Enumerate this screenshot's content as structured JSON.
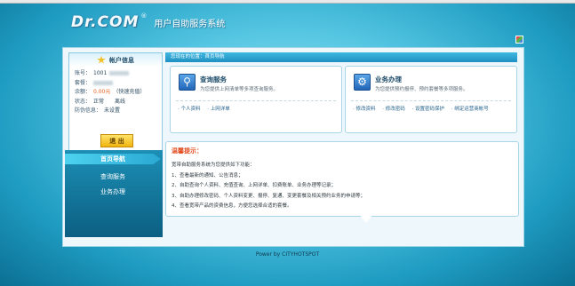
{
  "brand": {
    "logo_text": "Dr.COM",
    "reg_mark": "®",
    "subtitle": "用户自助服务系统"
  },
  "account": {
    "title": "帐户信息",
    "rows": [
      {
        "label": "账号：",
        "value": "1001"
      },
      {
        "label": "套餐：",
        "value": ""
      },
      {
        "label": "余额：",
        "value": "0.00元",
        "extra": "（快速充值）"
      },
      {
        "label": "状态：",
        "value": "正常",
        "extra": "离线"
      },
      {
        "label": "防伪信息：",
        "value": "未设置"
      }
    ],
    "logout_label": "退 出"
  },
  "nav": {
    "head": "首页导航",
    "items": [
      "查询服务",
      "业务办理"
    ]
  },
  "breadcrumb": "您现在的位置：首页导航",
  "panels": [
    {
      "title": "查询服务",
      "desc": "为您提供上网清单等多项查询服务。",
      "links": [
        "· 个人资料",
        "· 上网详单"
      ]
    },
    {
      "title": "业务办理",
      "desc": "为您提供预约报停、预约套餐等多项服务。",
      "links": [
        "· 修改资料",
        "· 修改密码",
        "· 设置密码保护",
        "· 绑定运营商帐号"
      ]
    }
  ],
  "tips": {
    "title": "温馨提示：",
    "intro": "宽带自助服务系统为您提供如下功能：",
    "items": [
      "1、查看最新的通知、公告消息；",
      "2、自助查询个人资料、充值查询、上网详单、扣费账单、业务办理等记录；",
      "3、自助办理修改密码、个人资料变更、报停、复通、变更套餐及相关预约业务的申请等；",
      "4、查看宽带产品的资费信息，方便您选择合适的套餐。"
    ]
  },
  "footer": "Power by CITYHOTSPOT",
  "colors": {
    "accent": "#1e90c2",
    "warn": "#e24c1f",
    "balance": "#e85c1c",
    "button": "#f0b40f"
  }
}
